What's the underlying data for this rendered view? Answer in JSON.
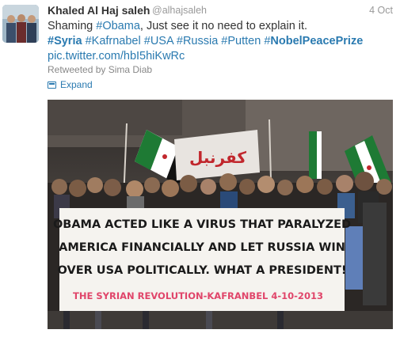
{
  "tweet": {
    "fullname": "Khaled Al Haj saleh",
    "username": "@alhajsaleh",
    "time": "4 Oct",
    "text_part1": "Shaming ",
    "tag_obama": "#Obama",
    "text_part2": ", Just see it no need to explain it.",
    "tag_syria": "#Syria",
    "tag_kafrnabel": "#Kafrnabel",
    "tag_usa": "#USA",
    "tag_russia": "#Russia",
    "tag_putten": "#Putten",
    "tag_nobel_hash": "#",
    "tag_nobel_word": "NobelPeacePrize",
    "link": "pic.twitter.com/hbI5hiKwRc",
    "retweeted_by": "Retweeted by Sima Diab",
    "expand_label": "Expand"
  },
  "photo": {
    "banner_line1": "OBAMA ACTED LIKE A VIRUS THAT PARALYZED",
    "banner_line2": "AMERICA FINANCIALLY AND LET RUSSIA WIN",
    "banner_line3": "OVER USA POLITICALLY. WHAT A PRESIDENT!",
    "banner_footer": "THE SYRIAN REVOLUTION-KAFRANBEL 4-10-2013",
    "top_sign": "كفرنبل"
  },
  "colors": {
    "link": "#2a7ab0",
    "name": "#333333",
    "meta": "#999999",
    "banner_ink": "#1a1a1a",
    "banner_footer_ink": "#e0456a"
  }
}
